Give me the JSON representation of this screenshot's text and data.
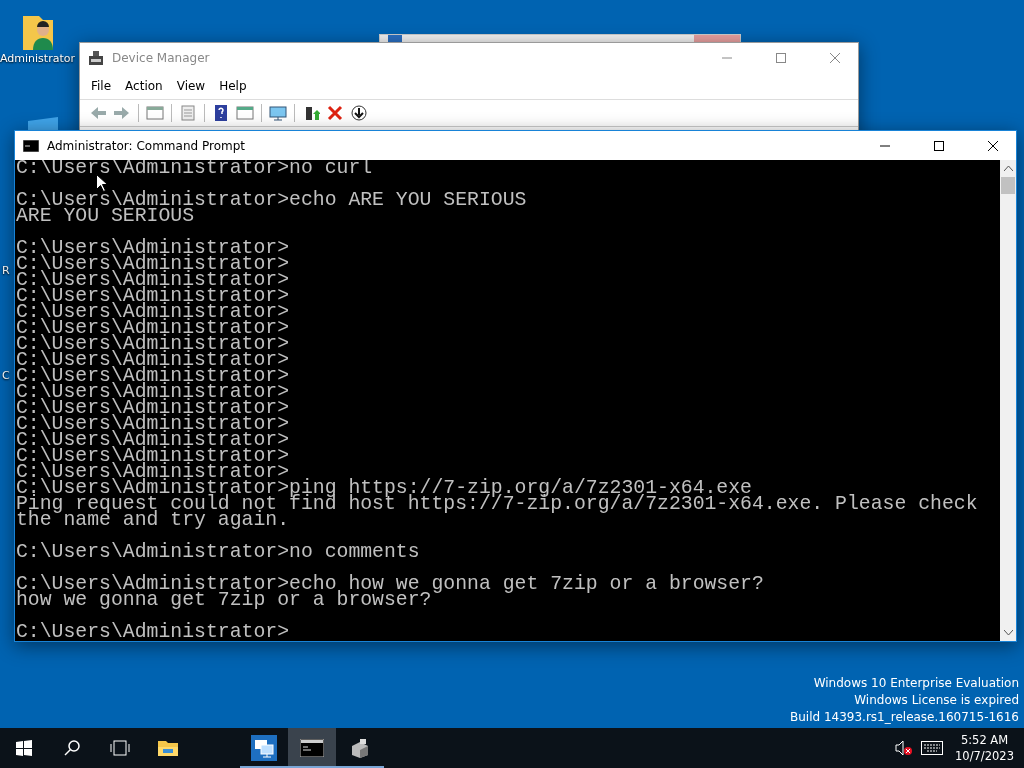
{
  "desktop_icons": [
    {
      "kind": "full",
      "label": "Administrator"
    },
    {
      "kind": "edge",
      "label": "R"
    },
    {
      "kind": "edge",
      "label": "C"
    }
  ],
  "device_manager": {
    "title": "Device Manager",
    "active": false,
    "menu": [
      "File",
      "Action",
      "View",
      "Help"
    ]
  },
  "command_prompt": {
    "title": "Administrator: Command Prompt",
    "active": true,
    "blocks": [
      [
        "C:\\Users\\Administrator>no curl"
      ],
      [
        "C:\\Users\\Administrator>echo ARE YOU SERIOUS",
        "ARE YOU SERIOUS"
      ],
      [
        "C:\\Users\\Administrator>",
        "C:\\Users\\Administrator>",
        "C:\\Users\\Administrator>",
        "C:\\Users\\Administrator>",
        "C:\\Users\\Administrator>",
        "C:\\Users\\Administrator>",
        "C:\\Users\\Administrator>",
        "C:\\Users\\Administrator>",
        "C:\\Users\\Administrator>",
        "C:\\Users\\Administrator>",
        "C:\\Users\\Administrator>",
        "C:\\Users\\Administrator>",
        "C:\\Users\\Administrator>",
        "C:\\Users\\Administrator>",
        "C:\\Users\\Administrator>",
        "C:\\Users\\Administrator>ping https://7-zip.org/a/7z2301-x64.exe",
        "Ping request could not find host https://7-zip.org/a/7z2301-x64.exe. Please check",
        "the name and try again."
      ],
      [
        "C:\\Users\\Administrator>no comments"
      ],
      [
        "C:\\Users\\Administrator>echo how we gonna get 7zip or a browser?",
        "how we gonna get 7zip or a browser?"
      ],
      [
        "C:\\Users\\Administrator>"
      ]
    ]
  },
  "watermark": [
    "Windows 10 Enterprise Evaluation",
    "Windows License is expired",
    "Build 14393.rs1_release.160715-1616"
  ],
  "taskbar": {
    "apps": [
      {
        "kind": "explorer",
        "running": false,
        "selected": false
      },
      {
        "kind": "network",
        "running": true,
        "selected": false
      },
      {
        "kind": "console",
        "running": true,
        "selected": true
      },
      {
        "kind": "devices",
        "running": true,
        "selected": false
      }
    ],
    "clock": {
      "time": "5:52 AM",
      "date": "10/7/2023"
    }
  }
}
